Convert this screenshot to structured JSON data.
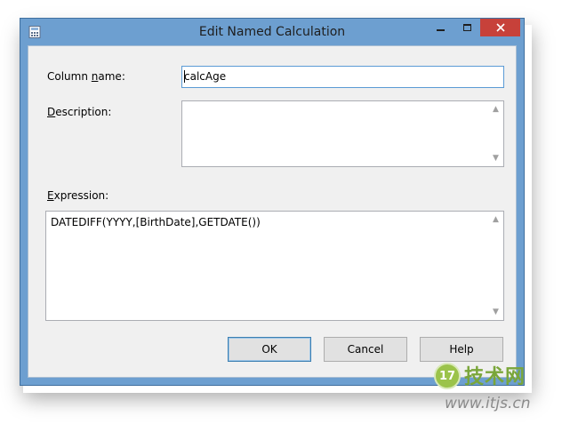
{
  "window": {
    "title": "Edit Named Calculation",
    "controls": {
      "minimize": "minimize-icon",
      "maximize": "maximize-icon",
      "close": "close-icon"
    }
  },
  "form": {
    "column_name_label": {
      "pre": "Column ",
      "key": "n",
      "post": "ame:"
    },
    "column_name_value": "calcAge",
    "description_label": {
      "key": "D",
      "post": "escription:"
    },
    "description_value": "",
    "expression_label": {
      "key": "E",
      "post": "xpression:"
    },
    "expression_value": "DATEDIFF(YYYY,[BirthDate],GETDATE())"
  },
  "buttons": {
    "ok": "OK",
    "cancel": "Cancel",
    "help": "Help"
  },
  "watermark": {
    "badge": "17",
    "brand": "技术网",
    "url": "www.itjs.cn"
  },
  "colors": {
    "titlebar": "#6d9fd0",
    "close": "#c7413a",
    "client": "#f0f0f0",
    "focus_border": "#5b9bd5"
  }
}
